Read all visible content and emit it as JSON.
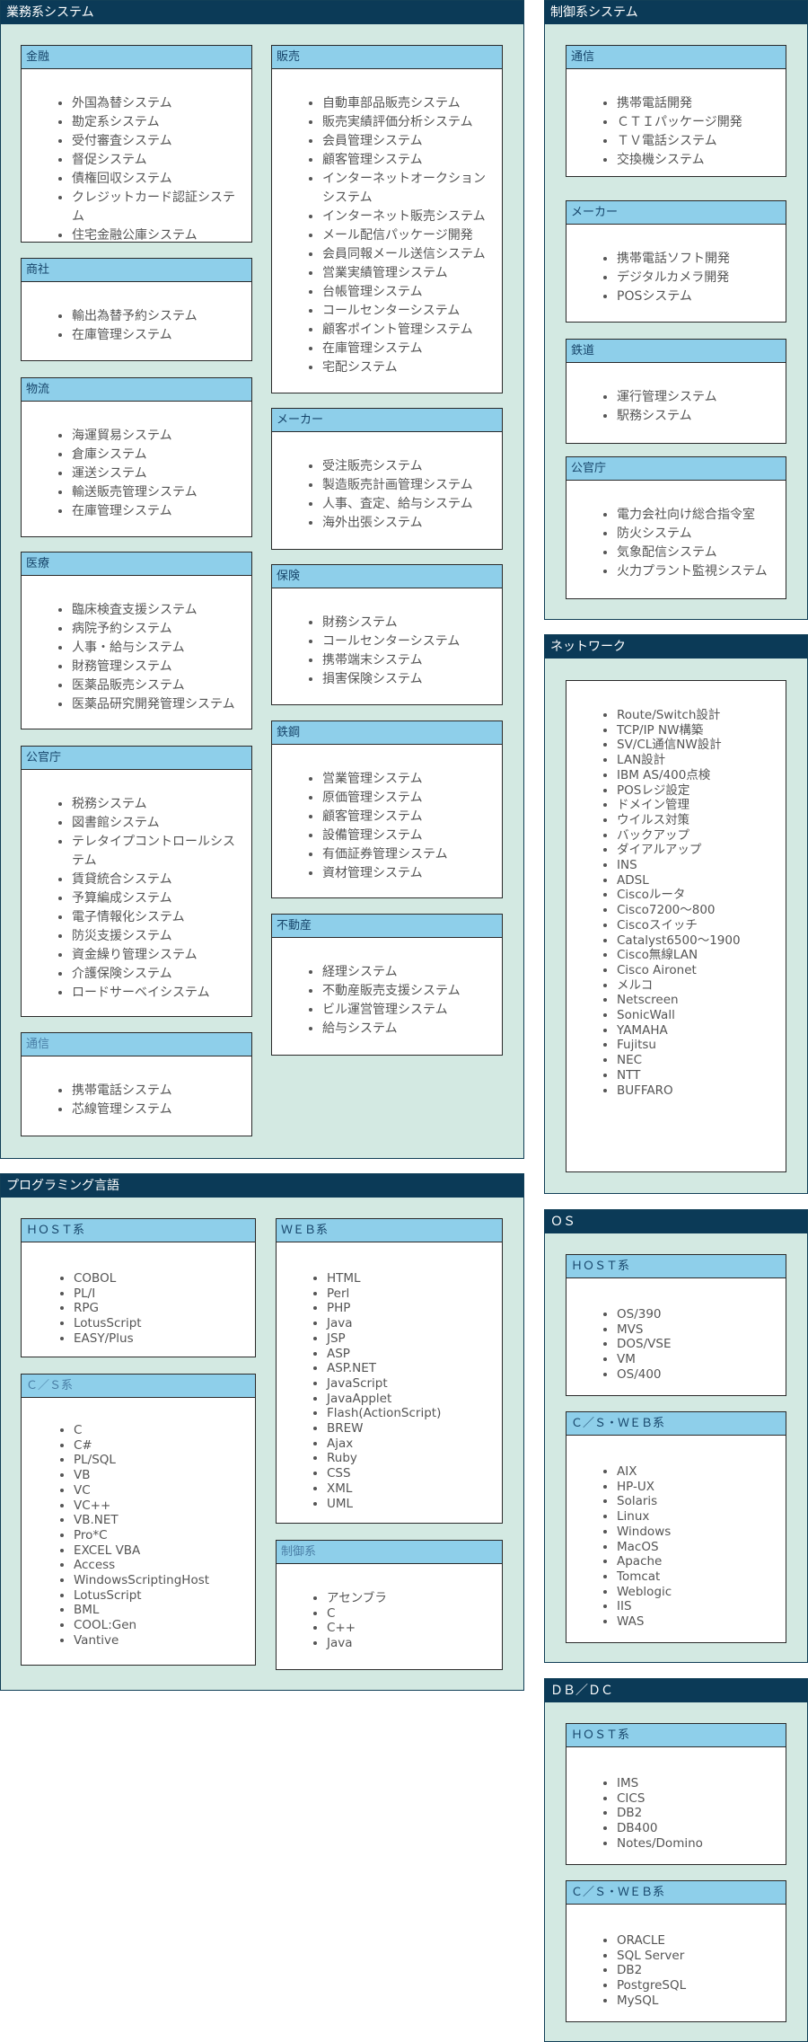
{
  "business": {
    "title": "業務系システム",
    "finance": {
      "title": "金融",
      "items": [
        "外国為替システム",
        "勘定系システム",
        "受付審査システム",
        "督促システム",
        "債権回収システム",
        "クレジットカード認証システム",
        "住宅金融公庫システム"
      ]
    },
    "trading": {
      "title": "商社",
      "items": [
        "輸出為替予約システム",
        "在庫管理システム"
      ]
    },
    "logistics": {
      "title": "物流",
      "items": [
        "海運貿易システム",
        "倉庫システム",
        "運送システム",
        "輸送販売管理システム",
        "在庫管理システム"
      ]
    },
    "medical": {
      "title": "医療",
      "items": [
        "臨床検査支援システム",
        "病院予約システム",
        "人事・給与システム",
        "財務管理システム",
        "医薬品販売システム",
        "医薬品研究開発管理システム"
      ]
    },
    "government": {
      "title": "公官庁",
      "items": [
        "税務システム",
        "図書館システム",
        "テレタイプコントロールシステム",
        "賃貸統合システム",
        "予算編成システム",
        "電子情報化システム",
        "防災支援システム",
        "資金繰り管理システム",
        "介護保険システム",
        "ロードサーベイシステム"
      ]
    },
    "telecom": {
      "title": "通信",
      "items": [
        "携帯電話システム",
        "芯線管理システム"
      ]
    },
    "sales": {
      "title": "販売",
      "items": [
        "自動車部品販売システム",
        "販売実績評価分析システム",
        "会員管理システム",
        "顧客管理システム",
        "インターネットオークションシステム",
        "インターネット販売システム",
        "メール配信パッケージ開発",
        "会員同報メール送信システム",
        "営業実績管理システム",
        "台帳管理システム",
        "コールセンターシステム",
        "顧客ポイント管理システム",
        "在庫管理システム",
        "宅配システム"
      ]
    },
    "maker": {
      "title": "メーカー",
      "items": [
        "受注販売システム",
        "製造販売計画管理システム",
        "人事、査定、給与システム",
        "海外出張システム"
      ]
    },
    "insurance": {
      "title": "保険",
      "items": [
        "財務システム",
        "コールセンターシステム",
        "携帯端末システム",
        "損害保険システム"
      ]
    },
    "steel": {
      "title": "鉄鋼",
      "items": [
        "営業管理システム",
        "原価管理システム",
        "顧客管理システム",
        "設備管理システム",
        "有価証券管理システム",
        "資材管理システム"
      ]
    },
    "realestate": {
      "title": "不動産",
      "items": [
        "経理システム",
        "不動産販売支援システム",
        "ビル運営管理システム",
        "給与システム"
      ]
    }
  },
  "control": {
    "title": "制御系システム",
    "telecom": {
      "title": "通信",
      "items": [
        "携帯電話開発",
        "ＣＴＩパッケージ開発",
        "ＴＶ電話システム",
        "交換機システム"
      ]
    },
    "maker": {
      "title": "メーカー",
      "items": [
        "携帯電話ソフト開発",
        "デジタルカメラ開発",
        "POSシステム"
      ]
    },
    "railway": {
      "title": "鉄道",
      "items": [
        "運行管理システム",
        "駅務システム"
      ]
    },
    "government": {
      "title": "公官庁",
      "items": [
        "電力会社向け総合指令室",
        "防火システム",
        "気象配信システム",
        "火力プラント監視システム"
      ]
    }
  },
  "network": {
    "title": "ネットワーク",
    "items": [
      "Route/Switch設計",
      "TCP/IP NW構築",
      "SV/CL通信NW設計",
      "LAN設計",
      "IBM AS/400点検",
      "POSレジ設定",
      "ドメイン管理",
      "ウイルス対策",
      "バックアップ",
      "ダイアルアップ",
      "INS",
      "ADSL",
      "Ciscoルータ",
      "Cisco7200～800",
      "Ciscoスイッチ",
      "Catalyst6500～1900",
      "Cisco無線LAN",
      "Cisco Aironet",
      "メルコ",
      "Netscreen",
      "SonicWall",
      "YAMAHA",
      "Fujitsu",
      "NEC",
      "NTT",
      "BUFFARO"
    ]
  },
  "programming": {
    "title": "プログラミング言語",
    "host": {
      "title": "ＨＯＳＴ系",
      "items": [
        "COBOL",
        "PL/I",
        "RPG",
        "LotusScript",
        "EASY/Plus"
      ]
    },
    "cs": {
      "title": "Ｃ／Ｓ系",
      "items": [
        "C",
        "C#",
        "PL/SQL",
        "VB",
        "VC",
        "VC++",
        "VB.NET",
        "Pro*C",
        "EXCEL VBA",
        "Access",
        "WindowsScriptingHost",
        "LotusScript",
        "BML",
        "COOL:Gen",
        "Vantive"
      ]
    },
    "web": {
      "title": "ＷＥＢ系",
      "items": [
        "HTML",
        "Perl",
        "PHP",
        "Java",
        "JSP",
        "ASP",
        "ASP.NET",
        "JavaScript",
        "JavaApplet",
        "Flash(ActionScript)",
        "BREW",
        "Ajax",
        "Ruby",
        "CSS",
        "XML",
        "UML"
      ]
    },
    "control": {
      "title": "制御系",
      "items": [
        "アセンブラ",
        "C",
        "C++",
        "Java"
      ]
    }
  },
  "os": {
    "title": "ＯＳ",
    "host": {
      "title": "ＨＯＳＴ系",
      "items": [
        "OS/390",
        "MVS",
        "DOS/VSE",
        "VM",
        "OS/400"
      ]
    },
    "csweb": {
      "title": "Ｃ／Ｓ・ＷＥＢ系",
      "items": [
        "AIX",
        "HP-UX",
        "Solaris",
        "Linux",
        "Windows",
        "MacOS",
        "Apache",
        "Tomcat",
        "Weblogic",
        "IIS",
        "WAS"
      ]
    }
  },
  "dbdc": {
    "title": "ＤＢ／ＤＣ",
    "host": {
      "title": "ＨＯＳＴ系",
      "items": [
        "IMS",
        "CICS",
        "DB2",
        "DB400",
        "Notes/Domino"
      ]
    },
    "csweb": {
      "title": "Ｃ／Ｓ・ＷＥＢ系",
      "items": [
        "ORACLE",
        "SQL Server",
        "DB2",
        "PostgreSQL",
        "MySQL"
      ]
    }
  }
}
